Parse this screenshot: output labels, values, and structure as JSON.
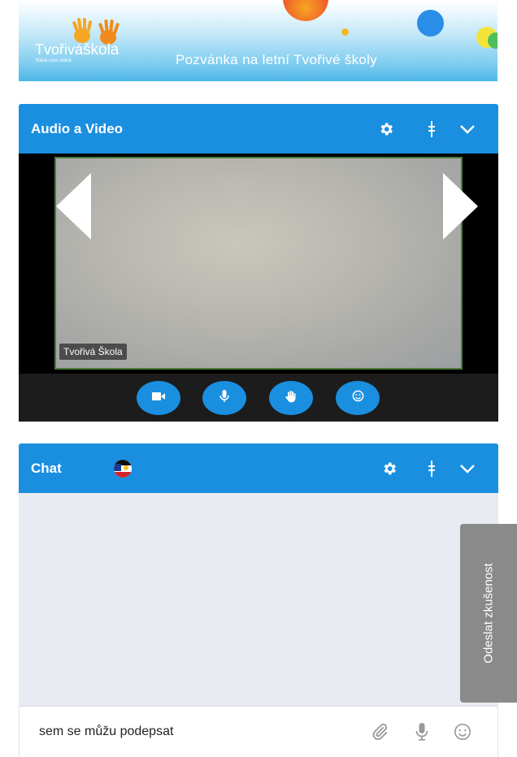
{
  "banner": {
    "logo_word1": "Tvořivá",
    "logo_word2": "škola",
    "logo_tagline": "Nava ruce srdce",
    "invite_text": "Pozvánka na letní Tvořivé školy"
  },
  "av_panel": {
    "title": "Audio a Video",
    "video_label": "Tvořivá Škola",
    "icons": [
      "gear-icon",
      "drag-handle-icon",
      "chevron-down-icon"
    ],
    "controls": [
      "video-camera-icon",
      "microphone-icon",
      "raise-hand-icon",
      "emoji-icon"
    ]
  },
  "chat_panel": {
    "title": "Chat",
    "icons": [
      "flag-icon",
      "gear-icon",
      "drag-handle-icon",
      "chevron-down-icon"
    ],
    "input_value": "sem se můžu podepsat",
    "input_icons": [
      "paperclip-icon",
      "microphone-icon",
      "smiley-icon"
    ]
  },
  "feedback_tab": {
    "label": "Odeslat zkušenost"
  },
  "colors": {
    "accent": "#1a8fe0",
    "video_bg": "#000000",
    "control_bar": "#1c1c1c",
    "chat_bg": "#e8ebf1",
    "feedback_bg": "#8a8a8a"
  }
}
